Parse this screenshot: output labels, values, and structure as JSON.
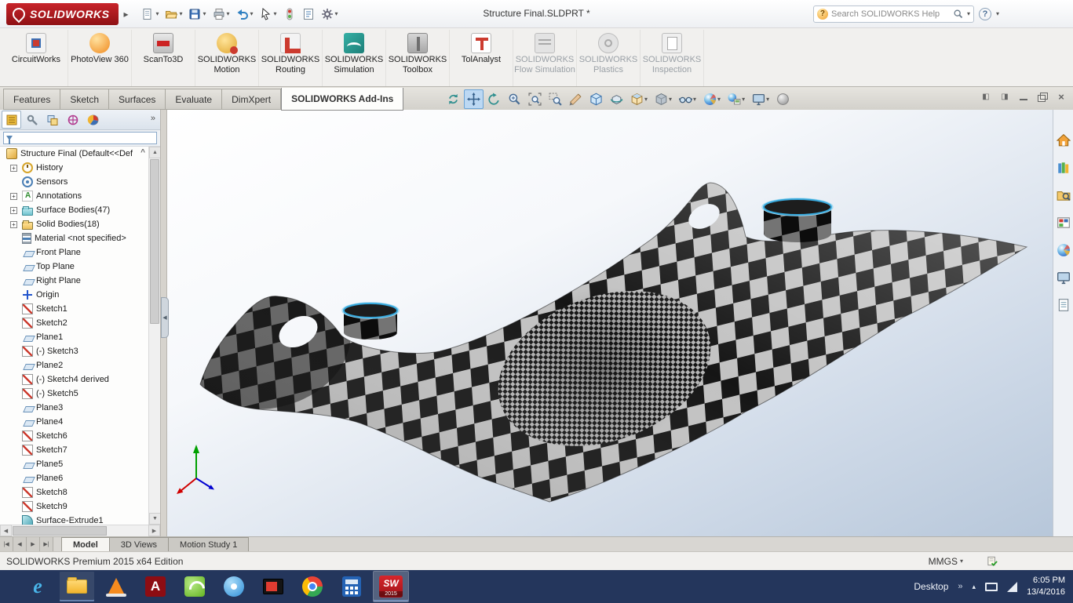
{
  "colors": {
    "accent_blue": "#37a9dd",
    "logo_red": "#b01116",
    "taskbar_bg": "#24365c",
    "viewport_top": "#ffffff",
    "viewport_bottom": "#b7c7da"
  },
  "titlebar": {
    "brand": "SOLIDWORKS",
    "document_title": "Structure Final.SLDPRT *",
    "search_placeholder": "Search SOLIDWORKS Help",
    "quick_access": [
      {
        "name": "new",
        "dropdown": true
      },
      {
        "name": "open",
        "dropdown": true
      },
      {
        "name": "save",
        "dropdown": true
      },
      {
        "name": "print",
        "dropdown": true
      },
      {
        "name": "undo",
        "dropdown": true
      },
      {
        "name": "select",
        "dropdown": true
      },
      {
        "name": "rebuild",
        "dropdown": false
      },
      {
        "name": "file-properties",
        "dropdown": false
      },
      {
        "name": "options",
        "dropdown": true
      }
    ]
  },
  "addins": [
    {
      "label": "CircuitWorks",
      "icon": "circuitworks",
      "enabled": true
    },
    {
      "label": "PhotoView 360",
      "icon": "photoview",
      "enabled": true
    },
    {
      "label": "ScanTo3D",
      "icon": "scanto3d",
      "enabled": true
    },
    {
      "label": "SOLIDWORKS Motion",
      "icon": "motion",
      "enabled": true
    },
    {
      "label": "SOLIDWORKS Routing",
      "icon": "routing",
      "enabled": true
    },
    {
      "label": "SOLIDWORKS Simulation",
      "icon": "simulation",
      "enabled": true
    },
    {
      "label": "SOLIDWORKS Toolbox",
      "icon": "toolbox",
      "enabled": true
    },
    {
      "label": "TolAnalyst",
      "icon": "tolanalyst",
      "enabled": true
    },
    {
      "label": "SOLIDWORKS Flow Simulation",
      "icon": "flow",
      "enabled": false
    },
    {
      "label": "SOLIDWORKS Plastics",
      "icon": "plastics",
      "enabled": false
    },
    {
      "label": "SOLIDWORKS Inspection",
      "icon": "inspection",
      "enabled": false
    }
  ],
  "command_tabs": [
    {
      "label": "Features",
      "active": false
    },
    {
      "label": "Sketch",
      "active": false
    },
    {
      "label": "Surfaces",
      "active": false
    },
    {
      "label": "Evaluate",
      "active": false
    },
    {
      "label": "DimXpert",
      "active": false
    },
    {
      "label": "SOLIDWORKS Add-Ins",
      "active": true
    }
  ],
  "headsup": [
    {
      "name": "redraw",
      "icon": "refresh",
      "dropdown": false,
      "active": false
    },
    {
      "name": "pan",
      "icon": "pan",
      "dropdown": false,
      "active": true
    },
    {
      "name": "previous-view",
      "icon": "prev",
      "dropdown": false,
      "active": false
    },
    {
      "name": "zoom-in-out",
      "icon": "zoom",
      "dropdown": false,
      "active": false
    },
    {
      "name": "zoom-to-fit",
      "icon": "zoomfit",
      "dropdown": false,
      "active": false
    },
    {
      "name": "zoom-to-area",
      "icon": "zoomarea",
      "dropdown": false,
      "active": false
    },
    {
      "name": "section-view",
      "icon": "section",
      "dropdown": false,
      "active": false
    },
    {
      "name": "3d-drawing-view",
      "icon": "cube3d",
      "dropdown": false,
      "active": false
    },
    {
      "name": "rotate-about-scene-floor",
      "icon": "rotate",
      "dropdown": false,
      "active": false
    },
    {
      "name": "view-orientation",
      "icon": "vieworient",
      "dropdown": true,
      "active": false
    },
    {
      "name": "display-style",
      "icon": "dispstyle",
      "dropdown": true,
      "active": false
    },
    {
      "name": "hide-show-items",
      "icon": "glasses",
      "dropdown": true,
      "active": false
    },
    {
      "name": "edit-appearance",
      "icon": "sphere",
      "dropdown": true,
      "active": false
    },
    {
      "name": "apply-scene",
      "icon": "scene",
      "dropdown": true,
      "active": false
    },
    {
      "name": "view-settings",
      "icon": "monitor",
      "dropdown": true,
      "active": false
    },
    {
      "name": "ambient-sphere",
      "icon": "graysphere",
      "dropdown": false,
      "active": false
    }
  ],
  "window_controls": [
    "pane-collapse",
    "pane-expand",
    "minimize",
    "restore",
    "close"
  ],
  "feature_manager": {
    "tabs": [
      "feature-tree",
      "property-manager",
      "configuration-manager",
      "dimxpert-manager",
      "display-manager"
    ],
    "root": "Structure Final (Default<<Def",
    "items": [
      {
        "label": "History",
        "icon": "history",
        "expandable": true
      },
      {
        "label": "Sensors",
        "icon": "sensors",
        "expandable": false
      },
      {
        "label": "Annotations",
        "icon": "annotations",
        "expandable": true
      },
      {
        "label": "Surface Bodies(47)",
        "icon": "surface-bodies",
        "expandable": true
      },
      {
        "label": "Solid Bodies(18)",
        "icon": "solid-bodies",
        "expandable": true
      },
      {
        "label": "Material <not specified>",
        "icon": "material",
        "expandable": false
      },
      {
        "label": "Front Plane",
        "icon": "plane",
        "expandable": false
      },
      {
        "label": "Top Plane",
        "icon": "plane",
        "expandable": false
      },
      {
        "label": "Right Plane",
        "icon": "plane",
        "expandable": false
      },
      {
        "label": "Origin",
        "icon": "origin",
        "expandable": false
      },
      {
        "label": "Sketch1",
        "icon": "sketch",
        "expandable": false
      },
      {
        "label": "Sketch2",
        "icon": "sketch",
        "expandable": false
      },
      {
        "label": "Plane1",
        "icon": "plane",
        "expandable": false
      },
      {
        "label": "(-) Sketch3",
        "icon": "sketch",
        "expandable": false
      },
      {
        "label": "Plane2",
        "icon": "plane",
        "expandable": false
      },
      {
        "label": "(-) Sketch4 derived",
        "icon": "sketch",
        "expandable": false
      },
      {
        "label": "(-) Sketch5",
        "icon": "sketch",
        "expandable": false
      },
      {
        "label": "Plane3",
        "icon": "plane",
        "expandable": false
      },
      {
        "label": "Plane4",
        "icon": "plane",
        "expandable": false
      },
      {
        "label": "Sketch6",
        "icon": "sketch",
        "expandable": false
      },
      {
        "label": "Sketch7",
        "icon": "sketch",
        "expandable": false
      },
      {
        "label": "Plane5",
        "icon": "plane",
        "expandable": false
      },
      {
        "label": "Plane6",
        "icon": "plane",
        "expandable": false
      },
      {
        "label": "Sketch8",
        "icon": "sketch",
        "expandable": false
      },
      {
        "label": "Sketch9",
        "icon": "sketch",
        "expandable": false
      },
      {
        "label": "Surface-Extrude1",
        "icon": "surface-extrude",
        "expandable": false
      }
    ]
  },
  "taskpane_icons": [
    "home",
    "design-library",
    "file-explorer",
    "view-palette",
    "appearances",
    "view-settings",
    "custom-properties"
  ],
  "bottom_tabs": [
    {
      "label": "Model",
      "active": true
    },
    {
      "label": "3D Views",
      "active": false
    },
    {
      "label": "Motion Study 1",
      "active": false
    }
  ],
  "status_bar": {
    "edition": "SOLIDWORKS Premium 2015 x64 Edition",
    "units": "MMGS"
  },
  "taskbar": {
    "apps": [
      {
        "name": "internet-explorer",
        "open": false
      },
      {
        "name": "file-explorer",
        "open": true
      },
      {
        "name": "vlc",
        "open": false
      },
      {
        "name": "adobe-reader",
        "open": false
      },
      {
        "name": "green-media-app",
        "open": false
      },
      {
        "name": "blue-messaging-app",
        "open": false
      },
      {
        "name": "tv-media-app",
        "open": false
      },
      {
        "name": "chrome",
        "open": false
      },
      {
        "name": "calculator",
        "open": false
      },
      {
        "name": "solidworks-2015",
        "open": true,
        "active": true,
        "badge": "SW",
        "badge_year": "2015"
      }
    ],
    "tray": {
      "desktop_label": "Desktop",
      "time": "6:05 PM",
      "date": "13/4/2016"
    }
  }
}
